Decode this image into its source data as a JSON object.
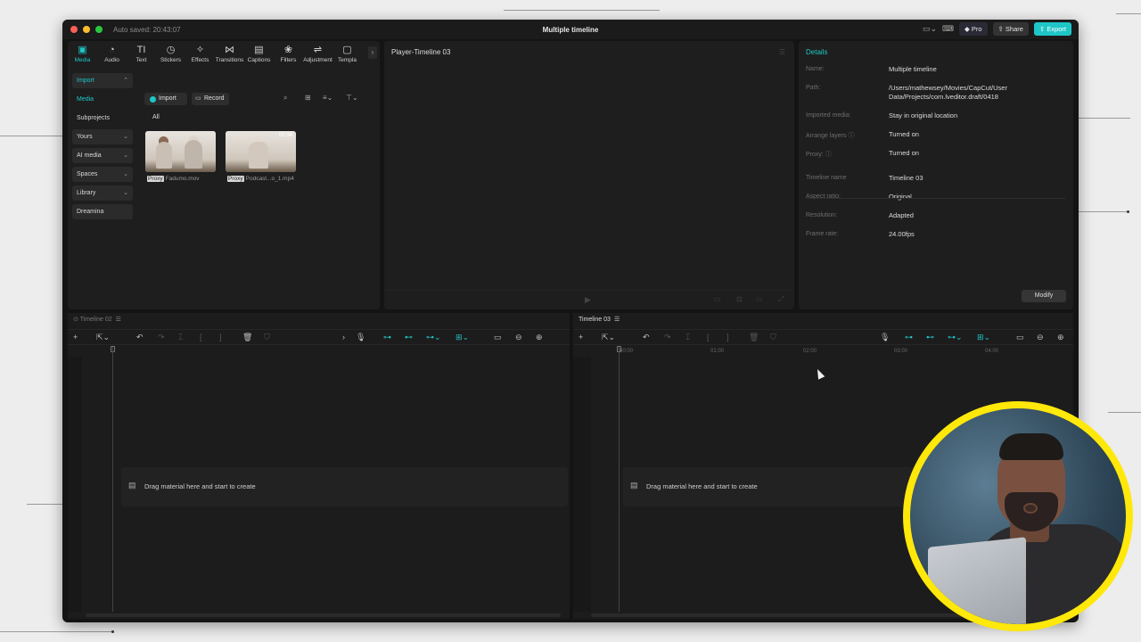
{
  "window": {
    "autosave": "Auto saved: 20:43:07",
    "title": "Multiple timeline",
    "pro_label": "Pro",
    "share_label": "Share",
    "export_label": "Export"
  },
  "toolbar": [
    {
      "label": "Media",
      "icon": "media-icon",
      "glyph": "▣",
      "active": true
    },
    {
      "label": "Audio",
      "icon": "audio-icon",
      "glyph": "◔"
    },
    {
      "label": "Text",
      "icon": "text-icon",
      "glyph": "TI"
    },
    {
      "label": "Stickers",
      "icon": "stickers-icon",
      "glyph": "◷"
    },
    {
      "label": "Effects",
      "icon": "effects-icon",
      "glyph": "✧"
    },
    {
      "label": "Transitions",
      "icon": "transitions-icon",
      "glyph": "⋈"
    },
    {
      "label": "Captions",
      "icon": "captions-icon",
      "glyph": "▤"
    },
    {
      "label": "Filters",
      "icon": "filters-icon",
      "glyph": "❀"
    },
    {
      "label": "Adjustment",
      "icon": "adjustment-icon",
      "glyph": "⇌"
    },
    {
      "label": "Templa",
      "icon": "templates-icon",
      "glyph": "▢"
    }
  ],
  "sidebar": [
    {
      "label": "Import",
      "style": "box teal",
      "chevron": "⌃"
    },
    {
      "label": "Media",
      "style": "teal"
    },
    {
      "label": "Subprojects",
      "style": ""
    },
    {
      "label": "Yours",
      "style": "box",
      "chevron": "⌄"
    },
    {
      "label": "AI media",
      "style": "box",
      "chevron": "⌄"
    },
    {
      "label": "Spaces",
      "style": "box",
      "chevron": "⌄"
    },
    {
      "label": "Library",
      "style": "box",
      "chevron": "⌄"
    },
    {
      "label": "Dreamina",
      "style": "box"
    }
  ],
  "media": {
    "import_label": "Import",
    "record_label": "Record",
    "filter_all": "All",
    "items": [
      {
        "proxy": "Proxy",
        "name": "Fadumo.mov",
        "duration": ""
      },
      {
        "proxy": "Proxy",
        "name": "Podcast...o_1.mp4",
        "duration": "00:34"
      }
    ]
  },
  "player": {
    "title": "Player-Timeline 03"
  },
  "details": {
    "title": "Details",
    "rows": [
      {
        "label": "Name:",
        "value": "Multiple timeline"
      },
      {
        "label": "Path:",
        "value": "/Users/mathewsey/Movies/CapCut/User Data/Projects/com.lveditor.draft/0418"
      },
      {
        "label": "Imported media:",
        "value": "Stay in original location"
      },
      {
        "label": "Arrange layers ⓘ",
        "value": "Turned on"
      },
      {
        "label": "Proxy: ⓘ",
        "value": "Turned on"
      },
      {
        "label": "Timeline name",
        "value": "Timeline 03"
      },
      {
        "label": "Aspect ratio:",
        "value": "Original"
      },
      {
        "label": "Resolution:",
        "value": "Adapted"
      },
      {
        "label": "Frame rate:",
        "value": "24.00fps"
      }
    ],
    "modify_label": "Modify"
  },
  "timelines": {
    "left": {
      "tab": "Timeline 02",
      "drop_text": "Drag material here and start to create"
    },
    "right": {
      "tab": "Timeline 03",
      "drop_text": "Drag material here and start to create",
      "ticks": [
        "00:00",
        "01:00",
        "02:00",
        "03:00",
        "04:00"
      ]
    }
  },
  "colors": {
    "accent": "#1fc6c8",
    "webcam_ring": "#ffe80a"
  }
}
